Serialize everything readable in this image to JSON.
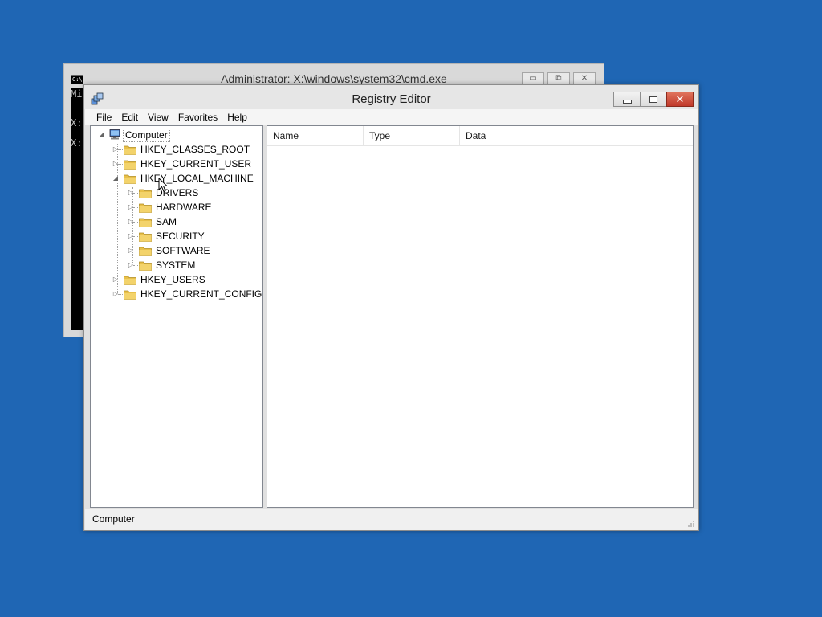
{
  "colors": {
    "desktop": "#1f66b4",
    "close_button": "#c0392b",
    "folder": "#e8c04a"
  },
  "cmd": {
    "title": "Administrator: X:\\windows\\system32\\cmd.exe",
    "icon": "cmd-icon",
    "console_lines": [
      "Mi",
      "X:",
      "X:"
    ],
    "icon_text": "C:\\"
  },
  "regedit": {
    "title": "Registry Editor",
    "icon": "regedit-icon",
    "menu": [
      "File",
      "Edit",
      "View",
      "Favorites",
      "Help"
    ],
    "tree": {
      "root": "Computer",
      "hives": [
        {
          "label": "HKEY_CLASSES_ROOT",
          "expanded": false
        },
        {
          "label": "HKEY_CURRENT_USER",
          "expanded": false
        },
        {
          "label": "HKEY_LOCAL_MACHINE",
          "expanded": true,
          "children": [
            "DRIVERS",
            "HARDWARE",
            "SAM",
            "SECURITY",
            "SOFTWARE",
            "SYSTEM"
          ]
        },
        {
          "label": "HKEY_USERS",
          "expanded": false
        },
        {
          "label": "HKEY_CURRENT_CONFIG",
          "expanded": false
        }
      ]
    },
    "columns": [
      "Name",
      "Type",
      "Data"
    ],
    "status": "Computer"
  }
}
